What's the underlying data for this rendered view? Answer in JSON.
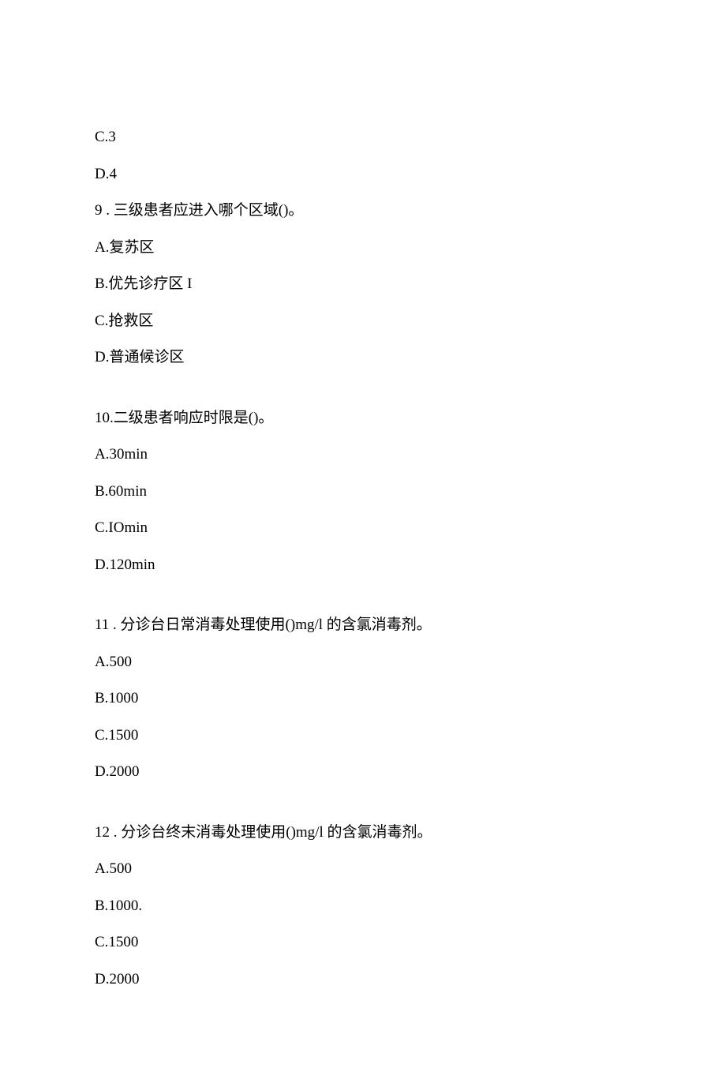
{
  "lines": {
    "l0": "C.3",
    "l1": "D.4",
    "l2": "9 . 三级患者应进入哪个区域()。",
    "l3": "A.复苏区",
    "l4": "B.优先诊疗区 I",
    "l5": "C.抢救区",
    "l6": "D.普通候诊区",
    "l7": "10.二级患者响应时限是()。",
    "l8": "A.30min",
    "l9": "B.60min",
    "l10": "C.IOmin",
    "l11": "D.120min",
    "l12": "11 . 分诊台日常消毒处理使用()mg/l 的含氯消毒剂。",
    "l13": "A.500",
    "l14": "B.1000",
    "l15": "C.1500",
    "l16": "D.2000",
    "l17": "12 . 分诊台终末消毒处理使用()mg/l 的含氯消毒剂。",
    "l18": "A.500",
    "l19": "B.1000.",
    "l20": "C.1500",
    "l21": "D.2000"
  }
}
